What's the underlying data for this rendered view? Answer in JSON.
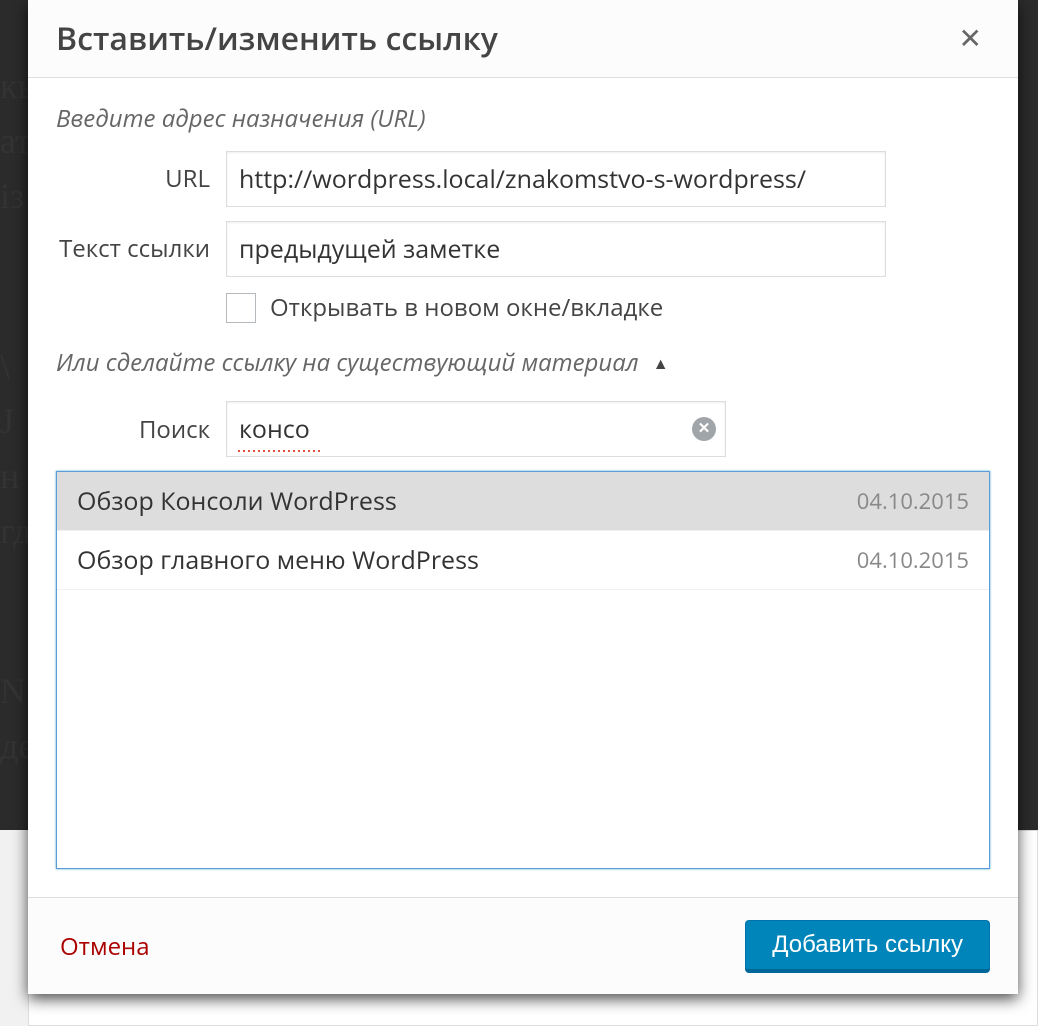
{
  "modal": {
    "title": "Вставить/изменить ссылку",
    "section1_label": "Введите адрес назначения (URL)",
    "url_label": "URL",
    "url_value": "http://wordpress.local/znakomstvo-s-wordpress/",
    "text_label": "Текст ссылки",
    "text_value": "предыдущей заметке",
    "newtab_label": "Открывать в новом окне/вкладке",
    "section2_label": "Или сделайте ссылку на существующий материал",
    "search_label": "Поиск",
    "search_value": "консо",
    "results": [
      {
        "title": "Обзор Консоли WordPress",
        "date": "04.10.2015"
      },
      {
        "title": "Обзор главного меню WordPress",
        "date": "04.10.2015"
      }
    ],
    "cancel": "Отмена",
    "submit": "Добавить ссылку"
  },
  "bg": {
    "l1": "кь",
    "l2": "ат",
    "l3": "із",
    "l4": " \\",
    "l5": "J",
    "l6": "н",
    "l7": "гд",
    "l8": "N",
    "l9": "де"
  }
}
